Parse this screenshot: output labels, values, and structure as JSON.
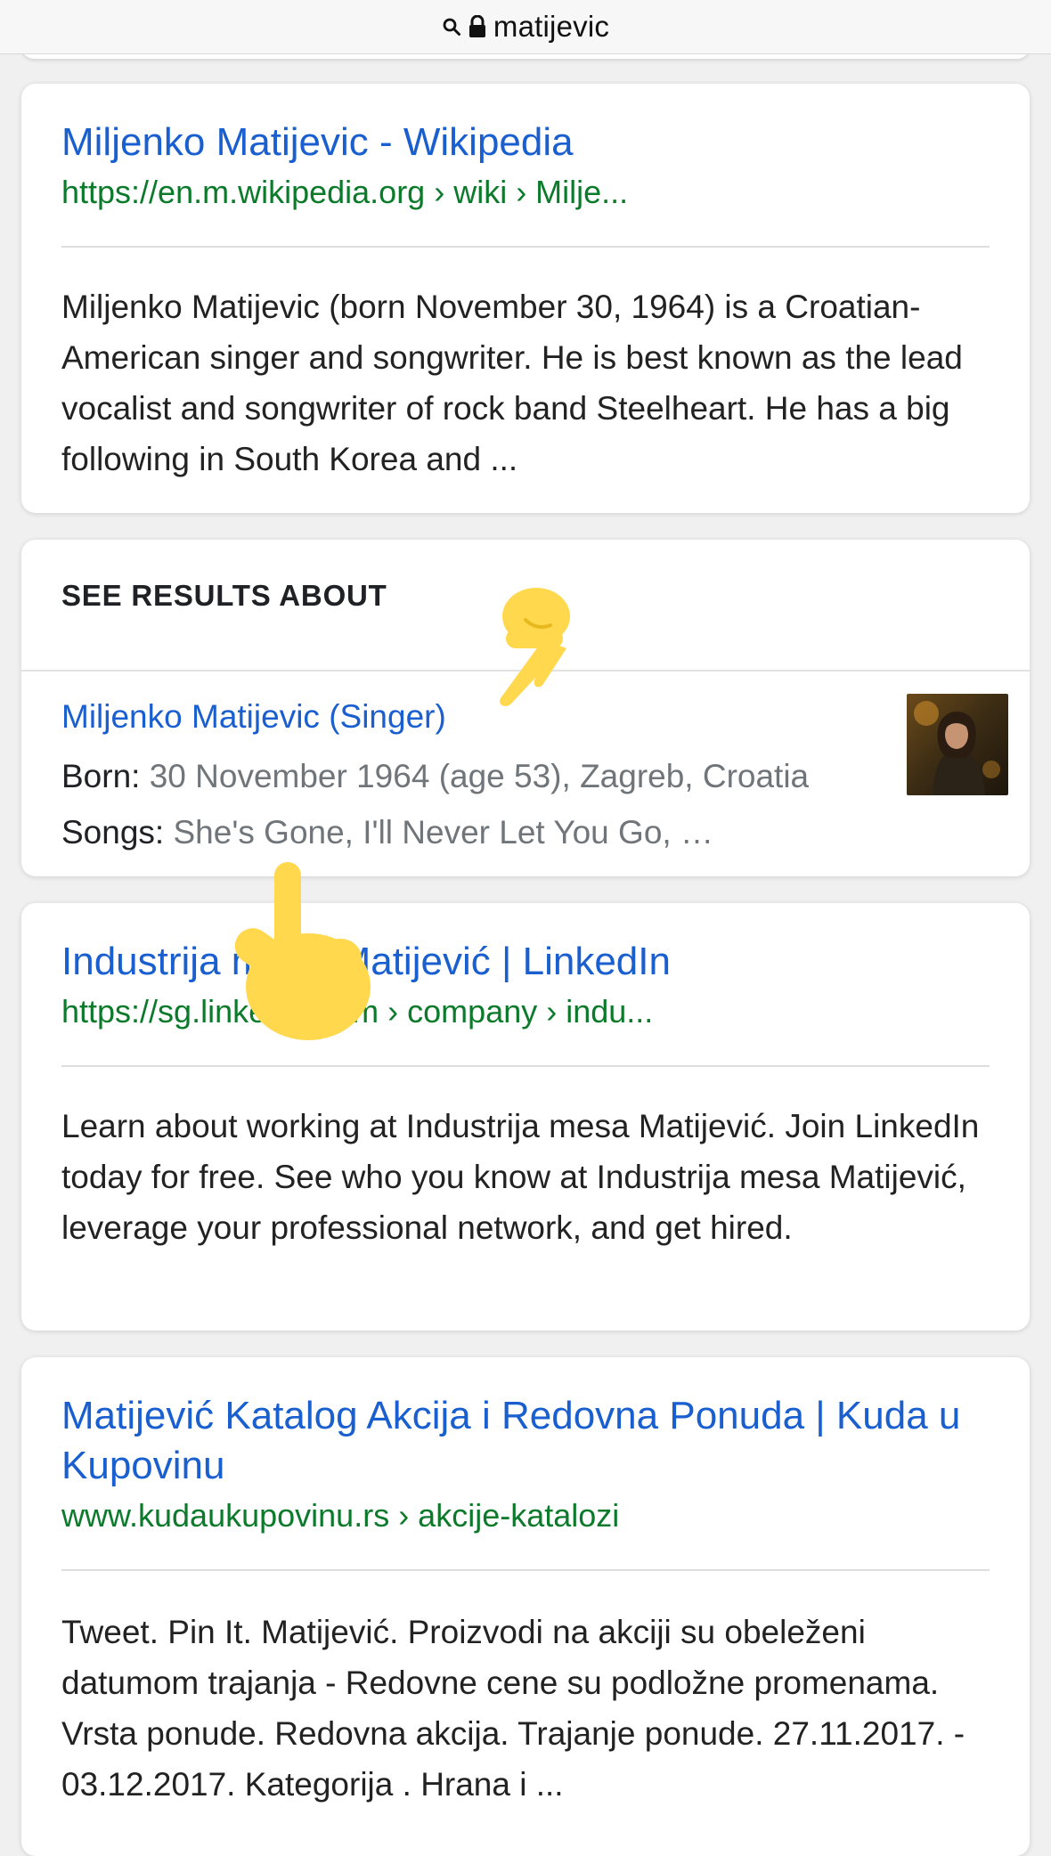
{
  "address_bar": {
    "text": "matijevic",
    "icons": [
      "search-icon",
      "lock-icon"
    ]
  },
  "results": [
    {
      "title": "Miljenko Matijevic - Wikipedia",
      "url": "https://en.m.wikipedia.org › wiki › Milje...",
      "snippet": "Miljenko Matijevic (born November 30, 1964) is a Croatian-American singer and songwriter. He is best known as the lead vocalist and songwriter of rock band Steelheart. He has a big following in South Korea and ..."
    },
    {
      "title": "Industrija mesa Matijević | LinkedIn",
      "url": "https://sg.linkedin.com › company › indu...",
      "snippet": "Learn about working at Industrija mesa Matijević. Join LinkedIn today for free. See who you know at Industrija mesa Matijević, leverage your professional network, and get hired."
    },
    {
      "title": "Matijević Katalog Akcija i Redovna Ponuda | Kuda u Kupovinu",
      "url": "www.kudaukupovinu.rs › akcije-katalozi",
      "snippet": "Tweet. Pin It. Matijević. Proizvodi na akciji su obeleženi datumom trajanja - Redovne cene su podložne promenama. Vrsta ponude. Redovna akcija. Trajanje ponude. 27.11.2017. - 03.12.2017. Kategorija . Hrana i ..."
    }
  ],
  "see_results_about": {
    "header": "SEE RESULTS ABOUT",
    "entity": {
      "title": "Miljenko Matijevic (Singer)",
      "born_label": "Born:",
      "born_value": " 30 November 1964 (age 53), Zagreb, Croatia",
      "songs_label": "Songs:",
      "songs_value": " She's Gone, I'll Never Let You Go, …"
    }
  },
  "annotations": [
    "pointing-hand-icon",
    "pointing-finger-icon"
  ],
  "colors": {
    "link": "#1a5fd0",
    "url": "#0c7a2b",
    "snippet": "#222222",
    "muted": "#70757a",
    "annotation": "#ffd84d"
  }
}
